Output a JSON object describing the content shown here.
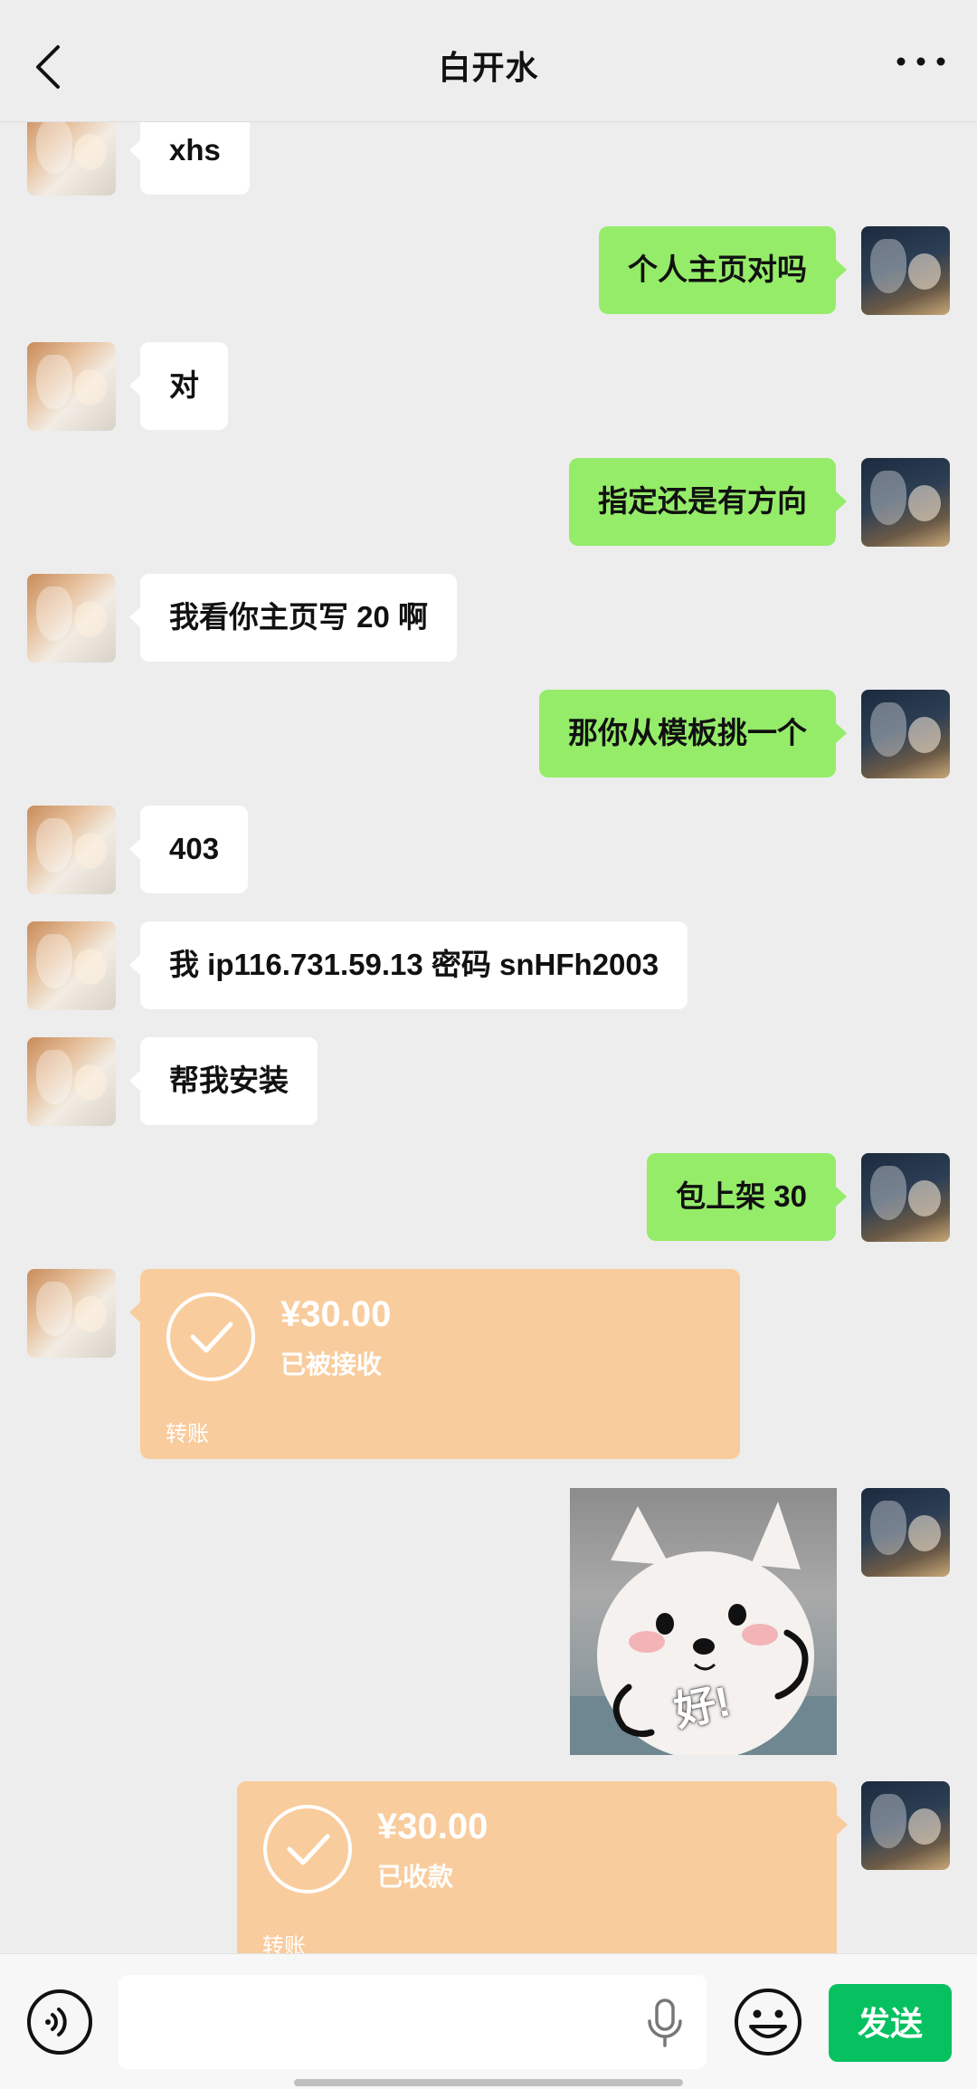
{
  "header": {
    "title": "白开水",
    "back_icon": "chevron-left-icon",
    "more_icon": "more-dots-icon"
  },
  "messages": [
    {
      "side": "left",
      "type": "text",
      "text": "xhs"
    },
    {
      "side": "right",
      "type": "text",
      "text": "个人主页对吗"
    },
    {
      "side": "left",
      "type": "text",
      "text": "对"
    },
    {
      "side": "right",
      "type": "text",
      "text": "指定还是有方向"
    },
    {
      "side": "left",
      "type": "text",
      "text": "我看你主页写 20 啊"
    },
    {
      "side": "right",
      "type": "text",
      "text": "那你从模板挑一个"
    },
    {
      "side": "left",
      "type": "text",
      "text": "403"
    },
    {
      "side": "left",
      "type": "text",
      "text": "我 ip116.731.59.13 密码 snHFh2003"
    },
    {
      "side": "left",
      "type": "text",
      "text": "帮我安装"
    },
    {
      "side": "right",
      "type": "text",
      "text": "包上架 30"
    },
    {
      "side": "left",
      "type": "transfer",
      "amount": "¥30.00",
      "status": "已被接收",
      "label": "转账"
    },
    {
      "side": "right",
      "type": "sticker",
      "caption": "好!"
    },
    {
      "side": "right",
      "type": "transfer",
      "amount": "¥30.00",
      "status": "已收款",
      "label": "转账"
    }
  ],
  "input_bar": {
    "voice_icon": "voice-mode-icon",
    "input_value": "",
    "mic_icon": "microphone-icon",
    "emoji_icon": "emoji-icon",
    "send_label": "发送"
  },
  "colors": {
    "background": "#ededed",
    "bubble_incoming": "#ffffff",
    "bubble_outgoing": "#95ec69",
    "transfer": "#f9cc9d",
    "send_button": "#07c160"
  }
}
